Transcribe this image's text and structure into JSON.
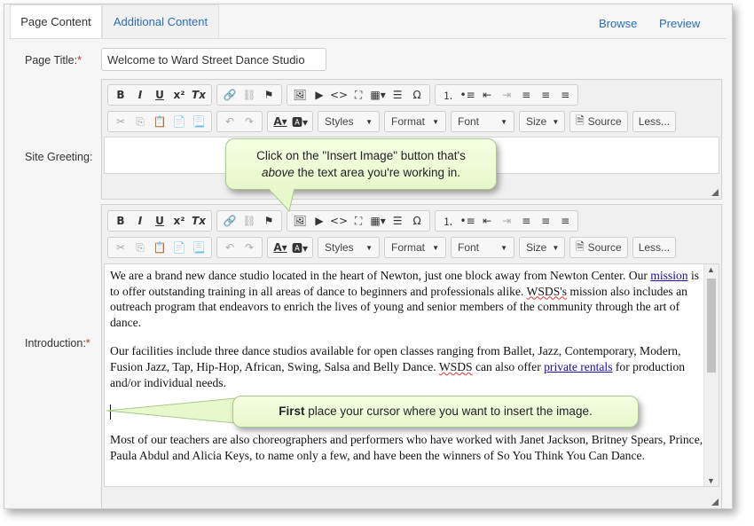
{
  "tabs": {
    "page_content": "Page Content",
    "additional_content": "Additional Content"
  },
  "header_links": {
    "browse": "Browse",
    "preview": "Preview"
  },
  "fields": {
    "page_title": {
      "label": "Page Title:",
      "required": "*",
      "value": "Welcome to Ward Street Dance Studio"
    },
    "site_greeting": {
      "label": "Site Greeting:"
    },
    "introduction": {
      "label": "Introduction:",
      "required": "*"
    }
  },
  "toolbar": {
    "bold": "B",
    "italic": "I",
    "underline": "U",
    "superscript": "x²",
    "remove_format": "Tx",
    "styles": "Styles",
    "format": "Format",
    "font": "Font",
    "size": "Size",
    "source": "Source",
    "less": "Less..."
  },
  "introduction_content": {
    "p1_before": "We are a brand new dance studio located in the heart of Newton, just one block away from Newton Center.   Our ",
    "p1_link": "mission",
    "p1_mid": " is to offer outstanding training in all areas of dance to beginners and professionals alike.  ",
    "p1_wsds": "WSDS's",
    "p1_after": " mission also includes an outreach program that endeavors to enrich the lives of young and senior members of the community through the art of dance.",
    "p2_before": "Our facilities include three dance studios available for open classes ranging from Ballet, Jazz, Contemporary, Modern, Fusion Jazz, Tap, Hip-Hop, African, Swing, Salsa and Belly Dance. ",
    "p2_wsds": "WSDS",
    "p2_mid": " can also offer ",
    "p2_link": "private rentals",
    "p2_after": " for production and/or individual needs.",
    "p3": "Most of our teachers are also choreographers and performers who have worked with Janet Jackson, Britney Spears, Prince, Paula Abdul and Alicia Keys, to name only a few, and have been the winners of So You Think You Can Dance."
  },
  "callouts": {
    "top_line1": "Click on the \"Insert Image\" button that's",
    "top_line2_em": "above",
    "top_line2_rest": " the text area you're working in.",
    "bottom_strong": "First",
    "bottom_rest": " place your cursor where you want to insert the image."
  },
  "colors": {
    "link": "#2a6ebb",
    "required": "#c9302c",
    "callout_fill": "#eafad2"
  }
}
